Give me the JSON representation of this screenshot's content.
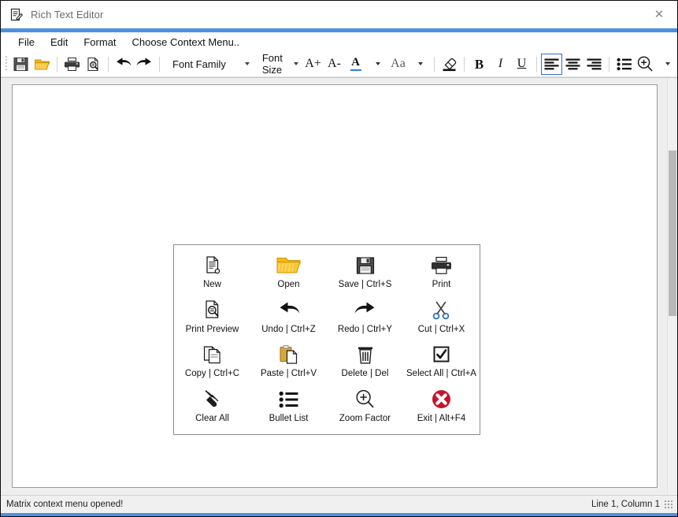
{
  "window": {
    "title": "Rich Text Editor",
    "title_icon": "notepad-pencil-icon",
    "close_label": "✕",
    "accent_color": "#4a90e2"
  },
  "menubar": {
    "items": [
      {
        "label": "File",
        "name": "menu-file"
      },
      {
        "label": "Edit",
        "name": "menu-edit"
      },
      {
        "label": "Format",
        "name": "menu-format"
      },
      {
        "label": "Choose Context Menu..",
        "name": "menu-choose-context-menu"
      }
    ]
  },
  "toolbar": {
    "buttons": [
      {
        "name": "save-button",
        "icon": "floppy-disk-icon"
      },
      {
        "name": "open-button",
        "icon": "folder-open-icon"
      },
      {
        "name": "print-button",
        "icon": "printer-icon"
      },
      {
        "name": "print-preview-button",
        "icon": "print-preview-icon"
      },
      {
        "name": "undo-button",
        "icon": "undo-arrow-icon"
      },
      {
        "name": "redo-button",
        "icon": "redo-arrow-icon"
      },
      {
        "name": "increase-font-size-button",
        "icon": "a-plus-icon",
        "text": "A+"
      },
      {
        "name": "decrease-font-size-button",
        "icon": "a-minus-icon",
        "text": "A-"
      },
      {
        "name": "font-color-button",
        "icon": "font-color-a-icon",
        "text": "A"
      },
      {
        "name": "change-case-button",
        "icon": "change-case-aa-icon",
        "text": "Aa"
      },
      {
        "name": "clear-formatting-button",
        "icon": "eraser-icon"
      },
      {
        "name": "bold-button",
        "icon": "bold-icon",
        "text": "B"
      },
      {
        "name": "italic-button",
        "icon": "italic-icon",
        "text": "I"
      },
      {
        "name": "underline-button",
        "icon": "underline-icon",
        "text": "U"
      },
      {
        "name": "align-left-button",
        "icon": "align-left-icon",
        "selected": true
      },
      {
        "name": "align-center-button",
        "icon": "align-center-icon"
      },
      {
        "name": "align-right-button",
        "icon": "align-right-icon"
      },
      {
        "name": "bullet-list-button",
        "icon": "bullet-list-icon"
      },
      {
        "name": "zoom-button",
        "icon": "magnifier-plus-icon"
      }
    ],
    "font_family": {
      "value": "Font Family",
      "placeholder": "Font Family"
    },
    "font_size": {
      "value": "Font Size",
      "placeholder": "Font Size"
    },
    "selected_alignment": "align-left"
  },
  "context_menu": {
    "name": "matrix-context-menu",
    "items": [
      {
        "label": "New",
        "icon": "new-document-icon"
      },
      {
        "label": "Open",
        "icon": "folder-open-icon"
      },
      {
        "label": "Save | Ctrl+S",
        "icon": "floppy-disk-icon"
      },
      {
        "label": "Print",
        "icon": "printer-icon"
      },
      {
        "label": "Print Preview",
        "icon": "print-preview-icon"
      },
      {
        "label": "Undo | Ctrl+Z",
        "icon": "undo-arrow-icon"
      },
      {
        "label": "Redo | Ctrl+Y",
        "icon": "redo-arrow-icon"
      },
      {
        "label": "Cut | Ctrl+X",
        "icon": "scissors-icon"
      },
      {
        "label": "Copy | Ctrl+C",
        "icon": "copy-pages-icon"
      },
      {
        "label": "Paste | Ctrl+V",
        "icon": "clipboard-paste-icon"
      },
      {
        "label": "Delete | Del",
        "icon": "trash-can-icon"
      },
      {
        "label": "Select All | Ctrl+A",
        "icon": "checked-box-icon"
      },
      {
        "label": "Clear All",
        "icon": "brush-clear-icon"
      },
      {
        "label": "Bullet List",
        "icon": "bullet-list-icon"
      },
      {
        "label": "Zoom Factor",
        "icon": "magnifier-plus-icon"
      },
      {
        "label": "Exit | Alt+F4",
        "icon": "red-x-circle-icon"
      }
    ]
  },
  "document": {
    "content": ""
  },
  "statusbar": {
    "message": "Matrix context menu opened!",
    "caret_position": "Line 1, Column 1",
    "grip": "resize-grip-icon"
  }
}
